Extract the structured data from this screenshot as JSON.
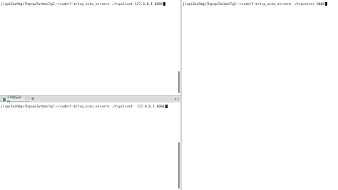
{
  "panes": {
    "top_left": {
      "prompt": "jlx@iZwz9dgc7hqvqa7wtbmi7qZ:~/code/Y-b/tcp_echo_server$ ./tcpclient 127.0.0.1 8080"
    },
    "right": {
      "prompt": "jlx@iZwz9dgc7hqvqa7wtbmi7qZ:~/code/Y-b/tcp_echo_server$ ./tcpserver 8080"
    },
    "bottom_left": {
      "prompt": "jlx@iZwz9dgc7hqvqa7wtbmi7qZ:~/code/Y-b/tcp_echo_server$ ./tcpclient  127.0.0.1 8080"
    }
  },
  "tabbar": {
    "tab_label": "1 阿里云主机",
    "close": "×",
    "add": "+"
  }
}
